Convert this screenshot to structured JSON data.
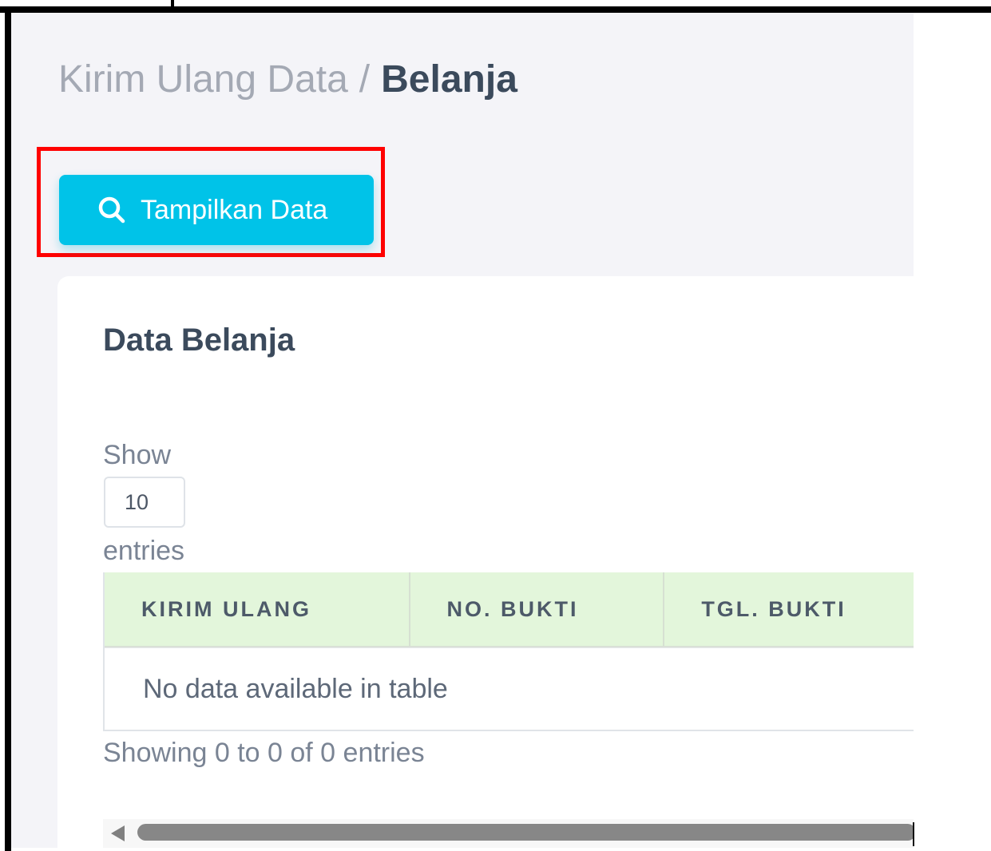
{
  "header": {
    "breadcrumb_parent": "Kirim Ulang Data",
    "breadcrumb_separator": "/",
    "breadcrumb_current": "Belanja"
  },
  "actions": {
    "show_data_label": "Tampilkan Data",
    "show_data_icon": "search-icon",
    "accent_color": "#00c3e8",
    "highlight_color": "#ff0000"
  },
  "card": {
    "title": "Data Belanja",
    "length": {
      "prefix": "Show",
      "value": "10",
      "suffix": "entries"
    },
    "table": {
      "columns": [
        "KIRIM ULANG",
        "NO. BUKTI",
        "TGL. BUKTI"
      ],
      "header_color": "#e3f6db",
      "empty_message": "No data available in table"
    },
    "info": "Showing 0 to 0 of 0 entries"
  }
}
